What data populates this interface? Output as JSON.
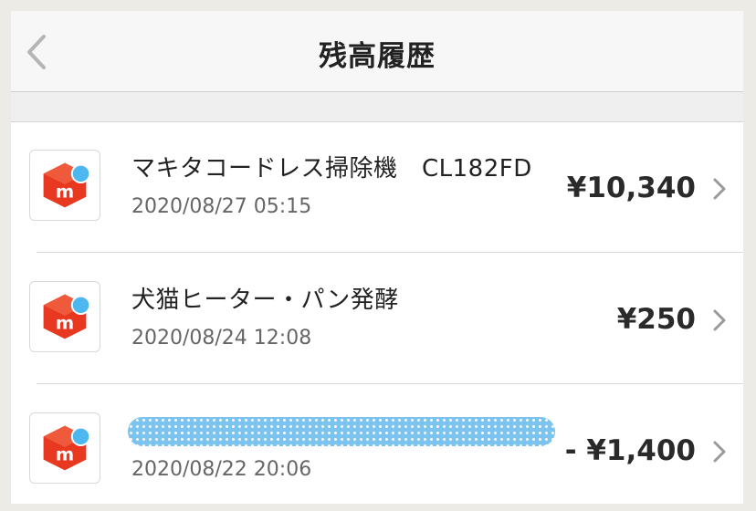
{
  "header": {
    "title": "残高履歴",
    "back_icon": "chevron-left-icon"
  },
  "items": [
    {
      "title": "マキタコードレス掃除機　CL182FD",
      "date": "2020/08/27 05:15",
      "amount": "¥10,340",
      "icon": "mercari-icon"
    },
    {
      "title": "犬猫ヒーター・パン発酵",
      "date": "2020/08/24 12:08",
      "amount": "¥250",
      "icon": "mercari-icon"
    },
    {
      "title": "",
      "date": "2020/08/22 20:06",
      "amount": "- ¥1,400",
      "icon": "mercari-icon"
    }
  ],
  "colors": {
    "brand_red": "#e83820",
    "brand_dot": "#4db7f0",
    "redaction": "#7cc3f0"
  }
}
